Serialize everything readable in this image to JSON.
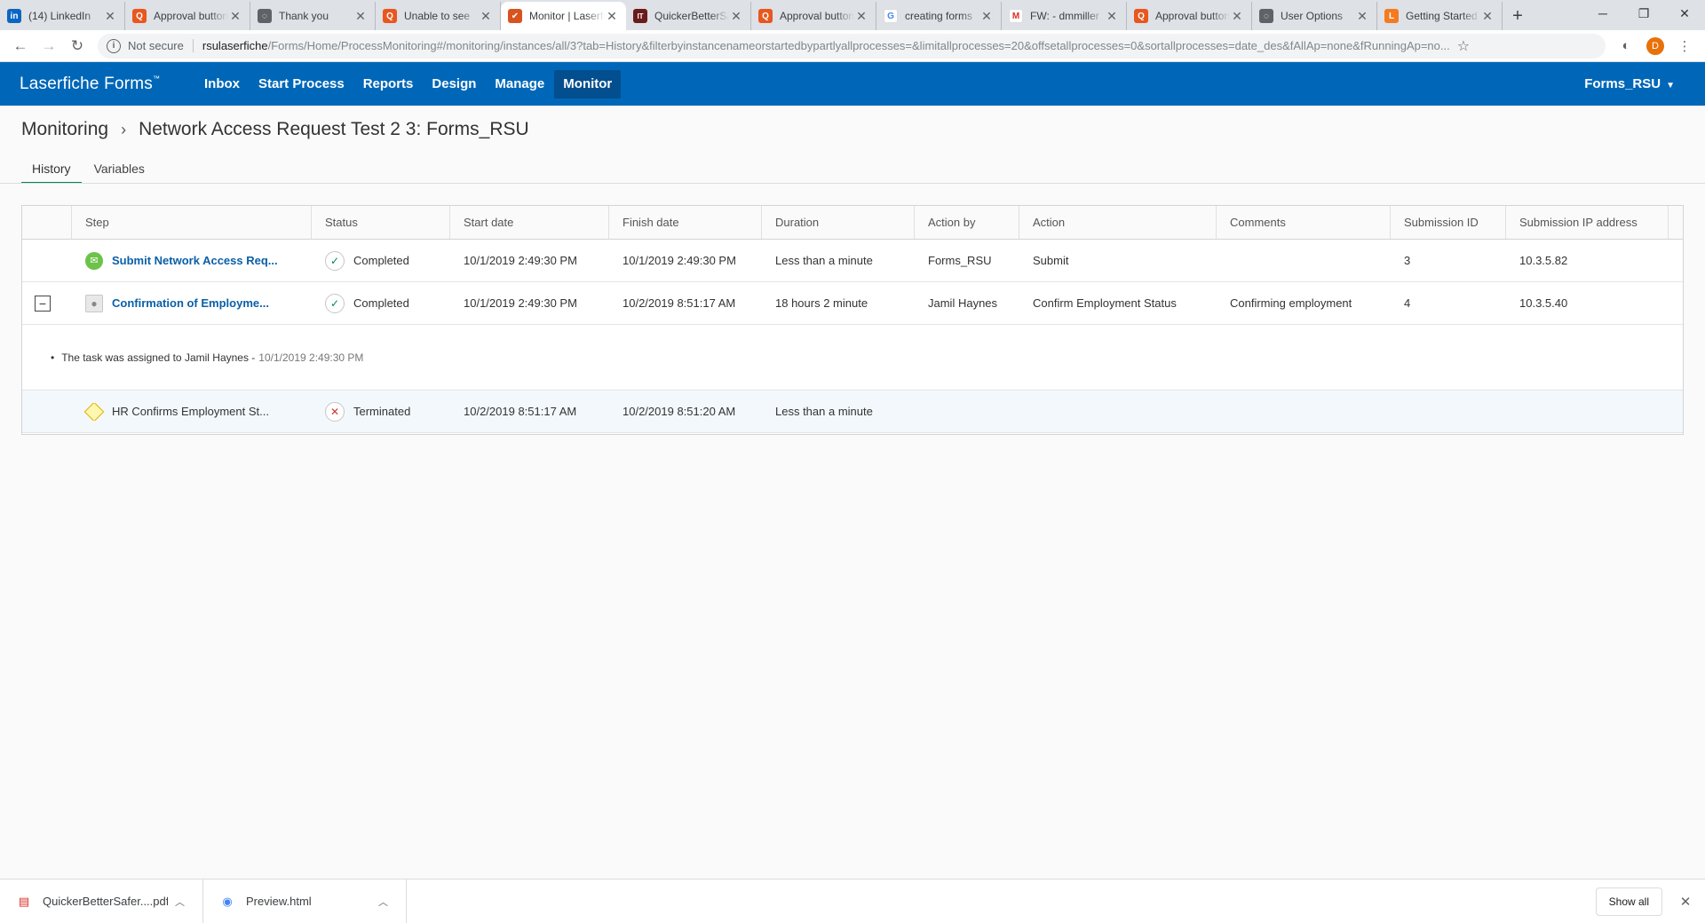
{
  "browser": {
    "tabs": [
      {
        "title": "(14) LinkedIn",
        "favicon": "in",
        "color": "#0a66c2",
        "icon": "linkedin-icon"
      },
      {
        "title": "Approval button",
        "favicon": "Q",
        "color": "#e8571e",
        "icon": "laserfiche-answers-icon"
      },
      {
        "title": "Thank you",
        "favicon": "◌",
        "color": "#5f6368",
        "icon": "globe-icon"
      },
      {
        "title": "Unable to see",
        "favicon": "Q",
        "color": "#e8571e",
        "icon": "laserfiche-answers-icon"
      },
      {
        "title": "Monitor | Laserfiche",
        "favicon": "✔",
        "color": "#d9531e",
        "icon": "laserfiche-forms-icon",
        "active": true
      },
      {
        "title": "QuickerBetterSafer",
        "favicon": "IT",
        "color": "#6b1b1b",
        "icon": "it-icon"
      },
      {
        "title": "Approval button",
        "favicon": "Q",
        "color": "#e8571e",
        "icon": "laserfiche-answers-icon"
      },
      {
        "title": "creating forms",
        "favicon": "G",
        "color": "#4285f4",
        "icon": "google-icon"
      },
      {
        "title": "FW: - dmmiller",
        "favicon": "M",
        "color": "#d93025",
        "icon": "gmail-icon"
      },
      {
        "title": "Approval button",
        "favicon": "Q",
        "color": "#e8571e",
        "icon": "laserfiche-answers-icon"
      },
      {
        "title": "User Options",
        "favicon": "◌",
        "color": "#5f6368",
        "icon": "globe-icon"
      },
      {
        "title": "Getting Started",
        "favicon": "L",
        "color": "#f47b20",
        "icon": "laserfiche-icon"
      }
    ],
    "security_label": "Not secure",
    "url_host": "rsulaserfiche",
    "url_path": "/Forms/Home/ProcessMonitoring#/monitoring/instances/all/3?tab=History&filterbyinstancenameorstartedbypartlyallprocesses=&limitallprocesses=20&offsetallprocesses=0&sortallprocesses=date_des&fAllAp=none&fRunningAp=no...",
    "profile_initial": "D"
  },
  "app": {
    "brand": "Laserfiche Forms",
    "brand_tm": "™",
    "nav": [
      {
        "label": "Inbox"
      },
      {
        "label": "Start Process"
      },
      {
        "label": "Reports"
      },
      {
        "label": "Design"
      },
      {
        "label": "Manage"
      },
      {
        "label": "Monitor",
        "active": true
      }
    ],
    "user": "Forms_RSU",
    "header_color": "#0067b8"
  },
  "breadcrumb": {
    "root": "Monitoring",
    "current": "Network Access Request Test 2 3: Forms_RSU"
  },
  "tabs": [
    {
      "label": "History",
      "active": true
    },
    {
      "label": "Variables"
    }
  ],
  "grid": {
    "columns": [
      "Step",
      "Status",
      "Start date",
      "Finish date",
      "Duration",
      "Action by",
      "Action",
      "Comments",
      "Submission ID",
      "Submission IP address"
    ],
    "rows": [
      {
        "step": "Submit Network Access Req...",
        "step_icon": "mail-icon",
        "status": "Completed",
        "start": "10/1/2019 2:49:30 PM",
        "finish": "10/1/2019 2:49:30 PM",
        "duration": "Less than a minute",
        "action_by": "Forms_RSU",
        "action": "Submit",
        "comments": "",
        "submission_id": "3",
        "ip": "10.3.5.82"
      },
      {
        "step": "Confirmation of Employme...",
        "step_icon": "user-icon",
        "status": "Completed",
        "start": "10/1/2019 2:49:30 PM",
        "finish": "10/2/2019 8:51:17 AM",
        "duration": "18 hours 2 minute",
        "action_by": "Jamil Haynes",
        "action": "Confirm Employment Status",
        "comments": "Confirming employment",
        "submission_id": "4",
        "ip": "10.3.5.40",
        "detail": {
          "text": "The task was assigned to Jamil Haynes -",
          "time": "10/1/2019 2:49:30 PM"
        }
      },
      {
        "step": "HR Confirms Employment St...",
        "step_icon": "diamond-icon",
        "status": "Terminated",
        "start": "10/2/2019 8:51:17 AM",
        "finish": "10/2/2019 8:51:20 AM",
        "duration": "Less than a minute",
        "action_by": "",
        "action": "",
        "comments": "",
        "submission_id": "",
        "ip": ""
      }
    ]
  },
  "downloads": {
    "items": [
      {
        "name": "QuickerBetterSafer....pdf",
        "icon": "pdf-icon"
      },
      {
        "name": "Preview.html",
        "icon": "chrome-icon"
      }
    ],
    "show_all": "Show all"
  }
}
